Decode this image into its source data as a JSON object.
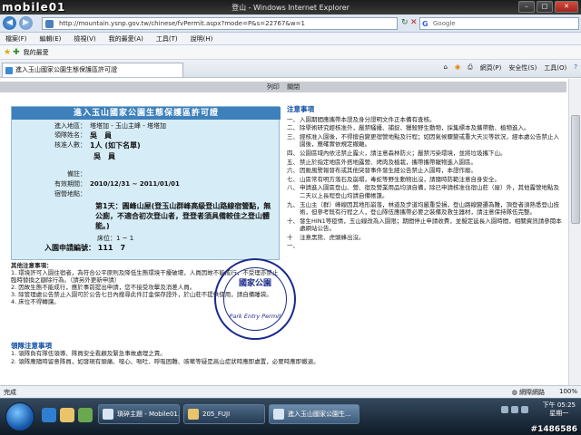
{
  "window": {
    "title": "登山 - Windows Internet Explorer"
  },
  "address_bar": {
    "url": "http://mountain.ysnp.gov.tw/chinese/fvPermit.aspx?mode=P&s=22767&w=1",
    "search_placeholder": "Google"
  },
  "menu": [
    "檔案(F)",
    "編輯(E)",
    "檢視(V)",
    "我的最愛(A)",
    "工具(T)",
    "說明(H)"
  ],
  "favorites": {
    "label": "我的最愛"
  },
  "tab": {
    "label": "進入玉山國家公園生態保護區許可證"
  },
  "toolbar": {
    "page": "網頁(P)",
    "safety": "安全性(S)",
    "tools": "工具(O)"
  },
  "print_bar": {
    "print": "列印",
    "close": "關閉"
  },
  "permit": {
    "title": "進入玉山國家公園生態保護區許可證",
    "fields": [
      {
        "label": "進入地區：",
        "value": "塔塔加 - 玉山主峰 - 塔塔加"
      },
      {
        "label": "領隊姓名：",
        "value": "吳　員"
      },
      {
        "label": "核准人數：",
        "value": "1人 (如下名單)"
      },
      {
        "label": "",
        "value": "吳　員"
      },
      {
        "label": "備註：",
        "value": ""
      },
      {
        "label": "有效期間：",
        "value": "2010/12/31 ~ 2011/01/01"
      },
      {
        "label": "宿營地點：",
        "value": ""
      }
    ],
    "camp": "第1天：圓峰山屋(登玉山群峰高級登山路線宿營點，無公廁，不適合初次登山者，登登者須具備較佳之登山體能。)",
    "bed": "床位：1 ~ 1",
    "entry_label": "入園申請編號：",
    "entry_number": "111　7"
  },
  "other_notice": {
    "heading": "其他注意事項：",
    "items": [
      "1. 環境許可入園住宿者，為符合公平原則及降低生態環境干擾破壞，人員因故不能成行，不受理亦禁止臨時替換之額除行為。（請另外更新申請）",
      "2. 因故生態不能成行，應於事前提出申請，您不接受攻擊及消差人員。",
      "3. 除管理處公告禁止入園可於公告七日內搜尋此件訂金保存證外，於山莊不提供使用，請自備睡袋。",
      "4. 床位不得轉讓。"
    ]
  },
  "stamp": {
    "text": "Park Entry Permit",
    "side": "國家公園"
  },
  "notice": {
    "heading": "注意事項",
    "items": [
      {
        "n": "一、",
        "t": "入園期間應攜帶本證及身分證明文件正本備有查核。"
      },
      {
        "n": "二、",
        "t": "除學術研究經核准外，嚴禁騷擾、捕捉、獵殺野生動物，採集標本及攜帶動、植物進入。"
      },
      {
        "n": "三、",
        "t": "經核准入園後，不得擅自變更宿營地點及行程；如因氣候驟變或重大天災等狀況，經本處公告禁止入園後，應確實依規定撤離。"
      },
      {
        "n": "四、",
        "t": "公園區域內依法禁止露火，請注意森林防火；嚴禁污染環境，並將垃圾攜下山。"
      },
      {
        "n": "五、",
        "t": "禁止於指定地區外搭地露營、烤肉及植栽，攜帶攜帶寵物進入園區。"
      },
      {
        "n": "六、",
        "t": "因颱風警報發布或其他突發事件發生經公告禁止入園時，本證作廢。"
      },
      {
        "n": "七、",
        "t": "山區常有明方落石及崩塌，毒蛇等野生動物出沒，請隨時防範注意自身安全。"
      },
      {
        "n": "八、",
        "t": "申請進入園區登山、營、宿及營業用品均須自備，除已申請核准住宿山莊（屋）外，其他露營地點及二天以上長程登山均請自備帳篷。"
      },
      {
        "n": "九、",
        "t": "玉山主（群）峰線因其地形崩落，林道及步道均嚴重受損，登山路線變遷為難，頂登者須熟悉登山技術，但參考既有行程之人，登山隊伍應攜帶必要之裝備及救生器材，請注意保持隊伍完整。"
      },
      {
        "n": "十、",
        "t": "發生HIN1等疫情，玉山線改為入園限；期間停止申請收費，並擬定延長入園時間，相關資訊請參閱本處網站公告。"
      },
      {
        "n": "十一、",
        "t": "注意黑熊、虎頭蜂出沒。"
      }
    ]
  },
  "leader_notice": {
    "heading": "領隊注意事項",
    "items": [
      "1. 領隊負有隊伍領導、隊員安全看顧及緊急事故處理之責。",
      "2. 領隊應隨時留意隊員，如發現有頭痛、噁心、嘔吐、呼吸困難、咳嗽等疑是高山症狀時應即處置，必要時應即撤退。"
    ]
  },
  "status": {
    "left": "完成",
    "zone": "網際網路",
    "zoom": "100%"
  },
  "taskbar": {
    "buttons": [
      "瑣碎主題 - Mobile01...",
      "205_FUJI",
      "進入玉山國家公園生..."
    ],
    "time": "下午 05:25",
    "day": "星期一"
  },
  "watermark": {
    "logo": "mobile01",
    "id": "#1486586"
  },
  "colors": {
    "permit_bg": "#d6ecf6",
    "permit_header": "#3d80bc",
    "notice_heading": "#0b4aa2",
    "stamp": "#1b2a8c"
  }
}
